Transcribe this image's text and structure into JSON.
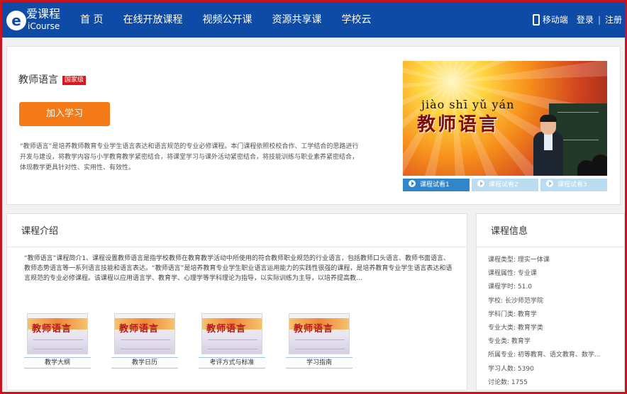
{
  "header": {
    "logo_cn": "爱课程",
    "logo_en": "iCourse",
    "logo_mark": "e",
    "nav": [
      "首 页",
      "在线开放课程",
      "视频公开课",
      "资源共享课",
      "学校云"
    ],
    "mobile_label": "移动端",
    "login": "登录",
    "separator": "|",
    "register": "注册"
  },
  "course": {
    "title": "教师语言",
    "badge": "国家级",
    "join_button": "加入学习",
    "description": "“教师语言”是培养教师教育专业学生语言表达和语言规范的专业必修课程。本门课程依照校校合作、工学结合的思路进行开发与建设，将教学内容与小学教育教学紧密结合，将课堂学习与课外活动紧密结合，将技能训练与职业素养紧密结合，体现教学更具针对性、实用性、有效性。",
    "video": {
      "pinyin": "jiào shī yǔ yán",
      "cn_title": "教师语言"
    },
    "video_tabs": [
      "课程试看1",
      "课程试看2",
      "课程试看3"
    ]
  },
  "intro": {
    "heading": "课程介绍",
    "text": "“教师语言”课程简介1、课程设置教师语言是指学校教师在教育教学活动中所使用的符合教师职业规范的行业语言，包括教师口头语言、教师书面语言、教师态势语言等一系列语言技能和语言表达。“教师语言”是培养教育专业学生职业语言运用能力的实践性很强的课程，是培养教育专业学生语言表达和语言规范的专业必修课程。该课程以应用语言学、教育学、心理学等学科理论为指导，以实际训练为主导，以培养提高教...",
    "resources": [
      {
        "label": "教学大纲",
        "thumb_text": "教师语言"
      },
      {
        "label": "教学日历",
        "thumb_text": "教师语言"
      },
      {
        "label": "考评方式与标准",
        "thumb_text": "教师语言"
      },
      {
        "label": "学习指南",
        "thumb_text": "教师语言"
      }
    ]
  },
  "info": {
    "heading": "课程信息",
    "items": [
      "课程类型: 理实一体课",
      "课程属性: 专业课",
      "课程学时: 51.0",
      "学校: 长沙师范学院",
      "学科门类: 教育学",
      "专业大类: 教育学类",
      "专业类: 教育学",
      "所属专业: 初等教育、语文教育、数学...",
      "学习人数: 5390",
      "讨论数: 1755"
    ]
  },
  "colors": {
    "header_blue": "#0e4ba6",
    "join_orange": "#f37a16",
    "badge_red": "#d9181e",
    "active_tab_blue": "#2f86cb",
    "frame_red": "#c8141e"
  }
}
